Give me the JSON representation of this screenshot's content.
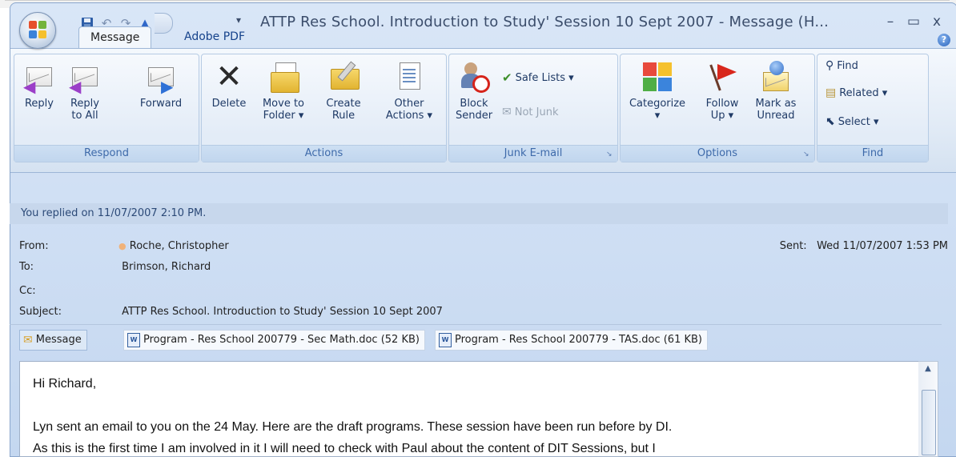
{
  "window": {
    "title": "ATTP Res School. Introduction to Study' Session 10 Sept 2007 - Message (H...",
    "minimize": "–",
    "maximize": "▭",
    "close": "x"
  },
  "tabs": [
    {
      "label": "Message",
      "active": true
    },
    {
      "label": "Adobe PDF",
      "active": false
    }
  ],
  "ribbon": {
    "respond": {
      "label": "Respond",
      "reply": "Reply",
      "reply_all_1": "Reply",
      "reply_all_2": "to All",
      "forward": "Forward"
    },
    "actions": {
      "label": "Actions",
      "delete": "Delete",
      "move_1": "Move to",
      "move_2": "Folder ▾",
      "create_1": "Create",
      "create_2": "Rule",
      "other_1": "Other",
      "other_2": "Actions ▾"
    },
    "junk": {
      "label": "Junk E-mail",
      "block_1": "Block",
      "block_2": "Sender",
      "safe_lists": "Safe Lists ▾",
      "not_junk": "Not Junk"
    },
    "options": {
      "label": "Options",
      "categorize": "Categorize",
      "categorize_2": "▾",
      "follow_1": "Follow",
      "follow_2": "Up ▾",
      "mark_1": "Mark as",
      "mark_2": "Unread"
    },
    "find": {
      "label": "Find",
      "find": "Find",
      "related": "Related ▾",
      "select": "Select ▾"
    }
  },
  "header": {
    "banner": "You replied on 11/07/2007 2:10 PM.",
    "from_label": "From:",
    "from_value": "Roche, Christopher",
    "to_label": "To:",
    "to_value": "Brimson, Richard",
    "cc_label": "Cc:",
    "cc_value": "",
    "subject_label": "Subject:",
    "subject_value": "ATTP Res School. Introduction to Study' Session 10 Sept 2007",
    "sent_label": "Sent:",
    "sent_value": "Wed 11/07/2007 1:53 PM"
  },
  "attachments": [
    {
      "label": "Message",
      "selected": true
    },
    {
      "label": "Program - Res School 200779 - Sec Math.doc (52 KB)",
      "selected": false
    },
    {
      "label": "Program - Res School 200779 - TAS.doc (61 KB)",
      "selected": false
    }
  ],
  "body": {
    "line1": "Hi Richard,",
    "line2": "",
    "line3": "Lyn sent an email to you on the 24 May. Here are the draft programs. These session have been run before by DI.",
    "line4": "As this is the first time I am involved in it I will need to check with Paul about the content of DIT Sessions, but I"
  }
}
